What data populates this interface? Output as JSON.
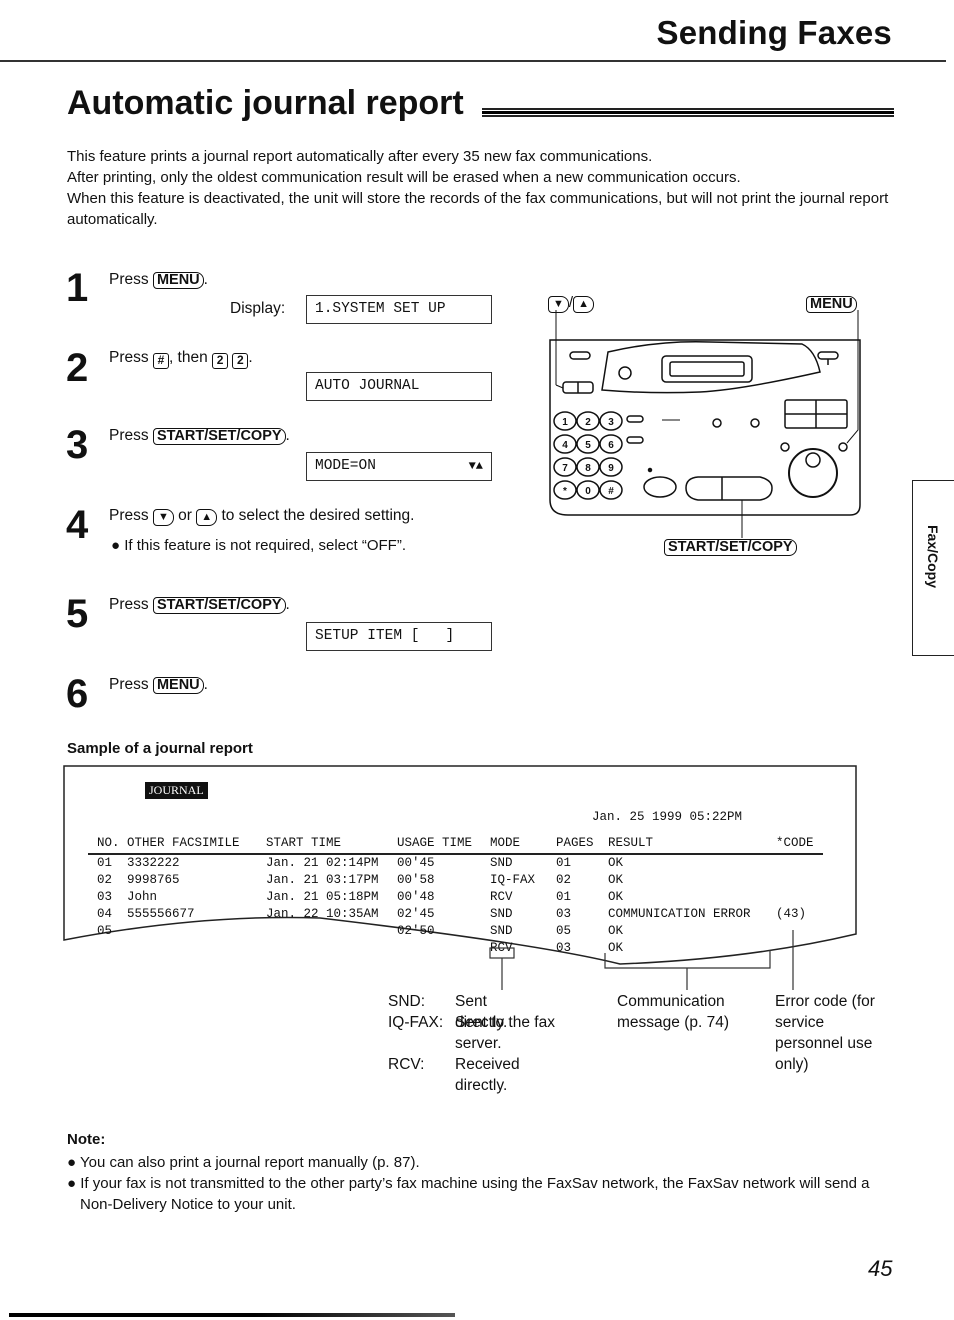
{
  "header": {
    "section_title": "Sending Faxes",
    "page_title": "Automatic journal report"
  },
  "intro": [
    "This feature prints a journal report automatically after every 35 new fax communications.",
    "After printing, only the oldest communication result will be erased when a new communication occurs.",
    "When this feature is deactivated, the unit will store the records of the fax communications, but will not print the journal report automatically."
  ],
  "steps": [
    {
      "number": "1",
      "prefix": "Press",
      "key": "MENU",
      "suffix": ".",
      "display_label": "Display:",
      "display": "1.SYSTEM SET UP"
    },
    {
      "number": "2",
      "prefix": "Press",
      "key1": "#",
      "mid": ", then",
      "key2": "2",
      "key3": "2",
      "suffix": ".",
      "display": "AUTO JOURNAL"
    },
    {
      "number": "3",
      "prefix": "Press",
      "key": "START/SET/COPY",
      "suffix": ".",
      "display": "MODE=ON",
      "display_arrows": "▼▲"
    },
    {
      "number": "4",
      "prefix": "Press",
      "key1": "▼",
      "mid": "or",
      "key2": "▲",
      "suffix": "to select the desired setting.",
      "bullet": "If this feature is not required, select “OFF”."
    },
    {
      "number": "5",
      "prefix": "Press",
      "key": "START/SET/COPY",
      "suffix": ".",
      "display": "SETUP ITEM [   ]"
    },
    {
      "number": "6",
      "prefix": "Press",
      "key": "MENU",
      "suffix": "."
    }
  ],
  "diagram": {
    "label_arrows": "▼",
    "label_arrows2": "▲",
    "label_slash": "/",
    "label_menu": "MENU",
    "label_start": "START/SET/COPY",
    "keypad": [
      "1",
      "2",
      "3",
      "4",
      "5",
      "6",
      "7",
      "8",
      "9",
      "*",
      "0",
      "#"
    ]
  },
  "sample": {
    "title": "Sample of a journal report",
    "badge": "JOURNAL",
    "date": "Jan. 25 1999 05:22PM",
    "columns": [
      "NO.",
      "OTHER FACSIMILE",
      "START TIME",
      "USAGE TIME",
      "MODE",
      "PAGES",
      "RESULT",
      "*CODE"
    ],
    "rows": [
      {
        "no": "01",
        "other": "3332222",
        "start": "Jan. 21 02:14PM",
        "usage": "00'45",
        "mode": "SND",
        "pages": "01",
        "result": "OK",
        "code": ""
      },
      {
        "no": "02",
        "other": "9998765",
        "start": "Jan. 21 03:17PM",
        "usage": "00'58",
        "mode": "IQ-FAX",
        "pages": "02",
        "result": "OK",
        "code": ""
      },
      {
        "no": "03",
        "other": "John",
        "start": "Jan. 21 05:18PM",
        "usage": "00'48",
        "mode": "RCV",
        "pages": "01",
        "result": "OK",
        "code": ""
      },
      {
        "no": "04",
        "other": "555556677",
        "start": "Jan. 22 10:35AM",
        "usage": "02'45",
        "mode": "SND",
        "pages": "03",
        "result": "COMMUNICATION ERROR",
        "code": "(43)"
      },
      {
        "no": "05",
        "other": "",
        "start": "",
        "usage": "02'50",
        "mode": "SND",
        "pages": "05",
        "result": "OK",
        "code": ""
      },
      {
        "no": "",
        "other": "",
        "start": "",
        "usage": "",
        "mode": "RCV",
        "pages": "03",
        "result": "OK",
        "code": ""
      }
    ],
    "legend_mode": [
      {
        "code": "SND:",
        "desc": "Sent directly."
      },
      {
        "code": "IQ-FAX:",
        "desc": "Sent to the fax server."
      },
      {
        "code": "RCV:",
        "desc": "Received directly."
      }
    ],
    "legend_result": "Communication message (p. 74)",
    "legend_code": "Error code (for service personnel use only)"
  },
  "side_tab": "Fax/Copy",
  "note": {
    "title": "Note:",
    "items": [
      "You can also print a journal report manually (p. 87).",
      "If your fax is not transmitted to the other party’s fax machine using the FaxSav network, the FaxSav network will send a Non-Delivery Notice to your unit."
    ]
  },
  "page_number": "45"
}
